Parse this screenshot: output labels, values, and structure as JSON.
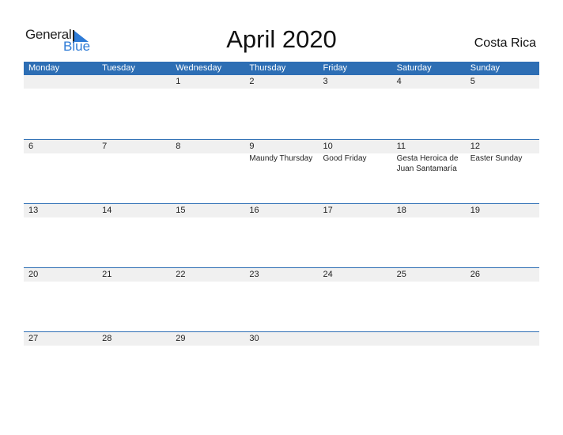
{
  "logo": {
    "general": "General",
    "blue": "Blue"
  },
  "title": "April 2020",
  "country": "Costa Rica",
  "weekdays": [
    "Monday",
    "Tuesday",
    "Wednesday",
    "Thursday",
    "Friday",
    "Saturday",
    "Sunday"
  ],
  "weeks": [
    {
      "days": [
        "",
        "",
        "1",
        "2",
        "3",
        "4",
        "5"
      ],
      "holidays": [
        "",
        "",
        "",
        "",
        "",
        "",
        ""
      ]
    },
    {
      "days": [
        "6",
        "7",
        "8",
        "9",
        "10",
        "11",
        "12"
      ],
      "holidays": [
        "",
        "",
        "",
        "Maundy Thursday",
        "Good Friday",
        "Gesta Heroica de Juan Santamaría",
        "Easter Sunday"
      ]
    },
    {
      "days": [
        "13",
        "14",
        "15",
        "16",
        "17",
        "18",
        "19"
      ],
      "holidays": [
        "",
        "",
        "",
        "",
        "",
        "",
        ""
      ]
    },
    {
      "days": [
        "20",
        "21",
        "22",
        "23",
        "24",
        "25",
        "26"
      ],
      "holidays": [
        "",
        "",
        "",
        "",
        "",
        "",
        ""
      ]
    },
    {
      "days": [
        "27",
        "28",
        "29",
        "30",
        "",
        "",
        ""
      ],
      "holidays": [
        "",
        "",
        "",
        "",
        "",
        "",
        ""
      ]
    }
  ],
  "colors": {
    "accent": "#2d6eb4",
    "logo_blue": "#2e7bd6",
    "row_bg": "#f0f0f0"
  }
}
